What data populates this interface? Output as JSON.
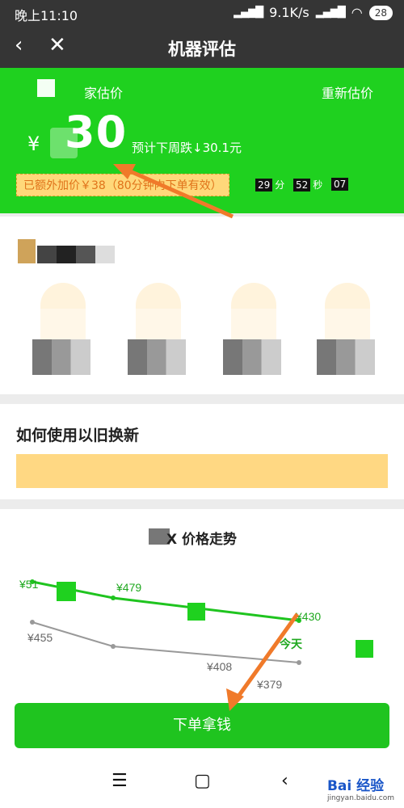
{
  "status_bar": {
    "time": "晚上11:10",
    "network_speed": "9.1K/s",
    "battery": "28"
  },
  "nav": {
    "title": "机器评估"
  },
  "estimate": {
    "label": "家估价",
    "reestimate": "重新估价",
    "currency": "¥",
    "price_visible": "30",
    "forecast": "预计下周跌↓30.1元",
    "bonus": "已额外加价￥38（80分钟内下单有效）",
    "countdown": [
      {
        "value": "29",
        "unit": "分"
      },
      {
        "value": "52",
        "unit": "秒"
      },
      {
        "value": "07",
        "unit": ""
      }
    ]
  },
  "howto": {
    "title": "如何使用以旧换新"
  },
  "trend": {
    "title": "X 价格走势",
    "today_label": "今天"
  },
  "chart_data": {
    "type": "line",
    "title": "X 价格走势",
    "series": [
      {
        "name": "",
        "color": "#1fc41f",
        "points": [
          "¥51",
          "¥479",
          "¥430"
        ],
        "values": [
          510,
          479,
          430
        ]
      },
      {
        "name": "",
        "color": "#999999",
        "points": [
          "¥455",
          "¥408",
          "¥379"
        ],
        "values": [
          455,
          408,
          379
        ]
      }
    ],
    "annotations": [
      "今天"
    ]
  },
  "cta": {
    "label": "下单拿钱"
  },
  "watermark": {
    "brand": "Bai 经验",
    "url": "jingyan.baidu.com"
  },
  "colors": {
    "brand_green": "#1fd11f",
    "dark_bar": "#353535",
    "bonus_bg": "#ffd87a",
    "bonus_text": "#e0731a",
    "arrow": "#f07a2a"
  }
}
